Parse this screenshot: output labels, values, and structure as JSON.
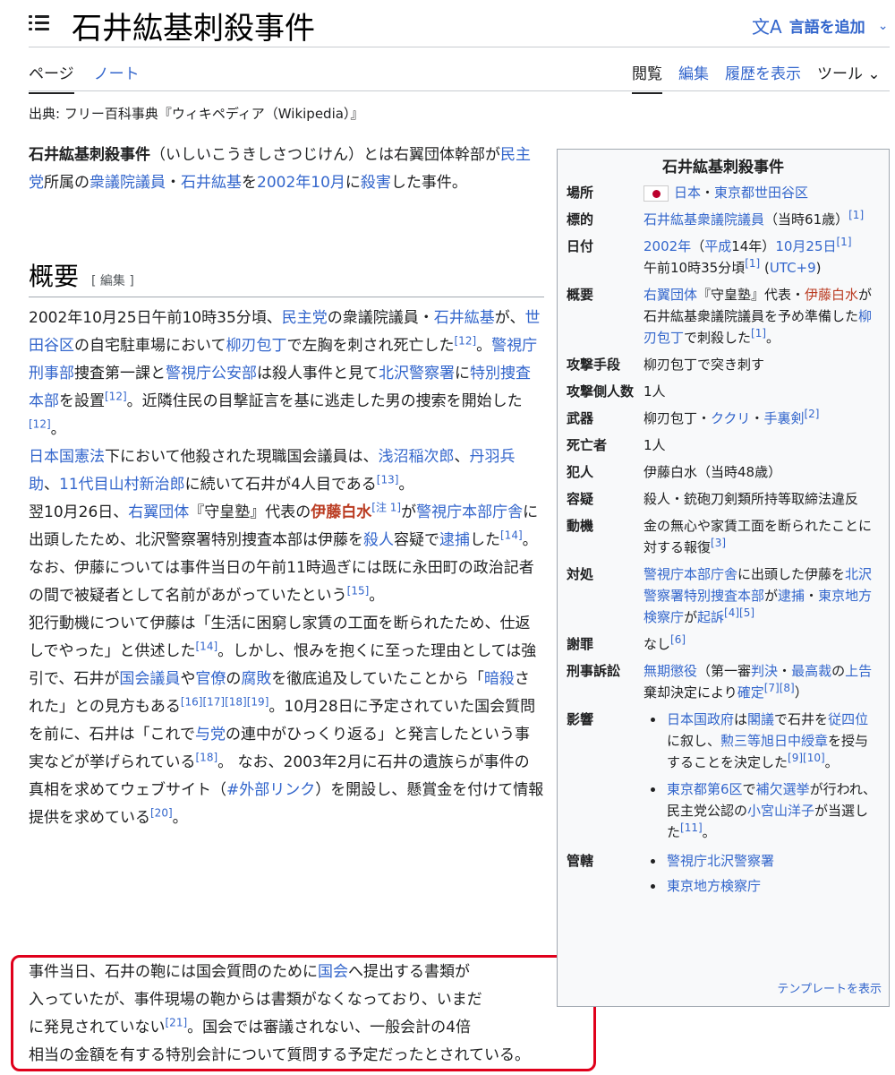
{
  "header": {
    "title": "石井紘基刺殺事件",
    "lang_label": "言語を追加",
    "lang_icon": "translate-icon"
  },
  "tabs": {
    "page": "ページ",
    "talk": "ノート",
    "read": "閲覧",
    "edit": "編集",
    "history": "履歴を表示",
    "tools": "ツール"
  },
  "source": "出典: フリー百科事典『ウィキペディア（Wikipedia）』",
  "section": {
    "heading": "概要",
    "edit": "[ 編集 ]"
  },
  "infobox": {
    "title": "石井紘基刺殺事件",
    "rows": [
      {
        "k": "場所",
        "v": "日本・東京都世田谷区"
      },
      {
        "k": "標的",
        "v": "石井紘基衆議院議員（当時61歳）",
        "ref": "[1]"
      },
      {
        "k": "日付",
        "v": "2002年（平成14年）10月25日",
        "ref": "[1]",
        "v2": "午前10時35分頃",
        "ref2": "[1]",
        "v3": "(UTC+9)"
      },
      {
        "k": "概要",
        "v": "右翼団体『守皇塾』代表・伊藤白水が石井紘基衆議院議員を予め準備した柳刃包丁で刺殺した",
        "ref": "[1]"
      },
      {
        "k": "攻撃手段",
        "v": "柳刃包丁で突き刺す"
      },
      {
        "k": "攻撃側人数",
        "v": "1人"
      },
      {
        "k": "武器",
        "v": "柳刃包丁・ククリ・手裏剣",
        "ref": "[2]"
      },
      {
        "k": "死亡者",
        "v": "1人"
      },
      {
        "k": "犯人",
        "v": "伊藤白水（当時48歳）"
      },
      {
        "k": "容疑",
        "v": "殺人・銃砲刀剣類所持等取締法違反"
      },
      {
        "k": "動機",
        "v": "金の無心や家賃工面を断られたことに対する報復",
        "ref": "[3]"
      },
      {
        "k": "対処",
        "v": "警視庁本部庁舎に出頭した伊藤を北沢警察署特別捜査本部が逮捕・東京地方検察庁が起訴",
        "ref": "[4][5]"
      },
      {
        "k": "謝罪",
        "v": "なし",
        "ref": "[6]"
      },
      {
        "k": "刑事訴訟",
        "v": "無期懲役（第一審判決・最高裁の上告棄却決定により確定",
        "ref": "[7][8]",
        "tail": "）"
      },
      {
        "k": "影響",
        "items": [
          "日本国政府は閣議で石井を従四位に叙し、勲三等旭日中綬章を授与することを決定した[9][10]。",
          "東京都第6区で補欠選挙が行われ、民主党公認の小宮山洋子が当選した[11]。"
        ]
      },
      {
        "k": "管轄",
        "items": [
          "警視庁北沢警察署",
          "東京地方検察庁"
        ]
      }
    ],
    "footer": "テンプレートを表示"
  },
  "box_text": "事件当日、石井の鞄には国会質問のために国会へ提出する書類が入っていたが、事件現場の鞄からは書類がなくなっており、いまだに発見されていない[21]。国会では審議されない、一般会計の4倍相当の金額を有する特別会計について質問する予定だったとされている。"
}
